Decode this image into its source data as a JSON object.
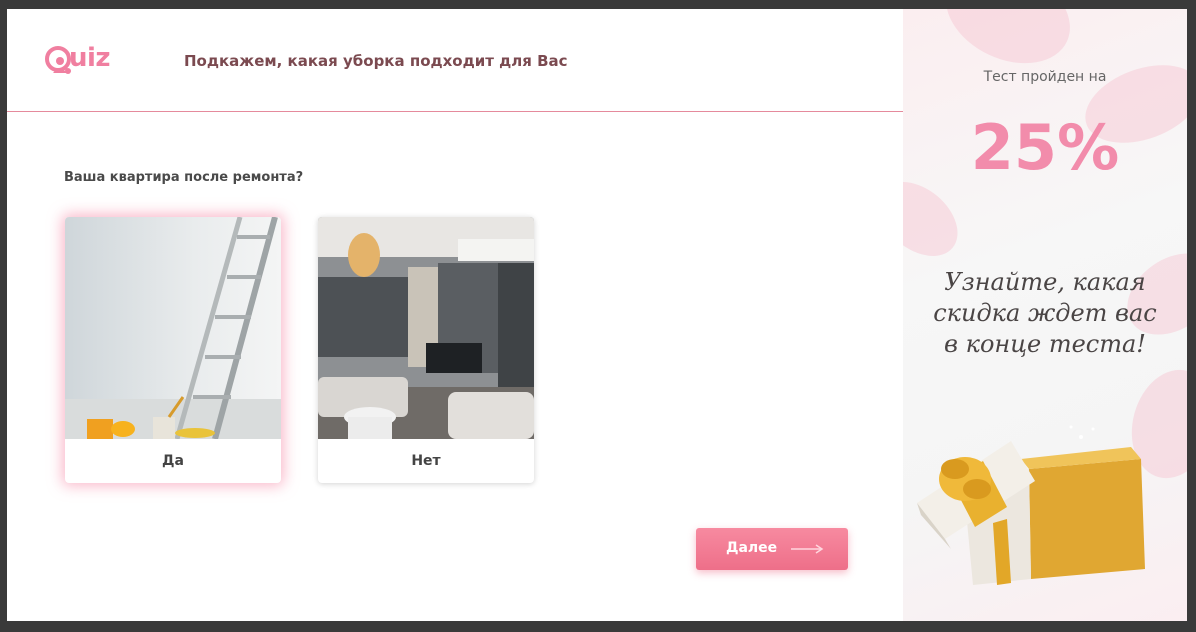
{
  "header": {
    "logo_text": "uiz",
    "title": "Подкажем, какая уборка подходит для Вас"
  },
  "question": "Ваша квартира после ремонта?",
  "options": [
    {
      "label": "Да",
      "selected": true
    },
    {
      "label": "Нет",
      "selected": false
    }
  ],
  "next_button": {
    "label": "Далее"
  },
  "sidebar": {
    "progress_caption": "Тест пройден на",
    "progress_value": "25%",
    "promo_text": "Узнайте, какая скидка ждет вас в конце теста!"
  },
  "colors": {
    "accent": "#f07fa0",
    "title": "#7b4a50",
    "button": "#ee6f89"
  },
  "icons": [
    "quiz-logo-icon",
    "arrow-right-icon",
    "gift-box-icon"
  ]
}
